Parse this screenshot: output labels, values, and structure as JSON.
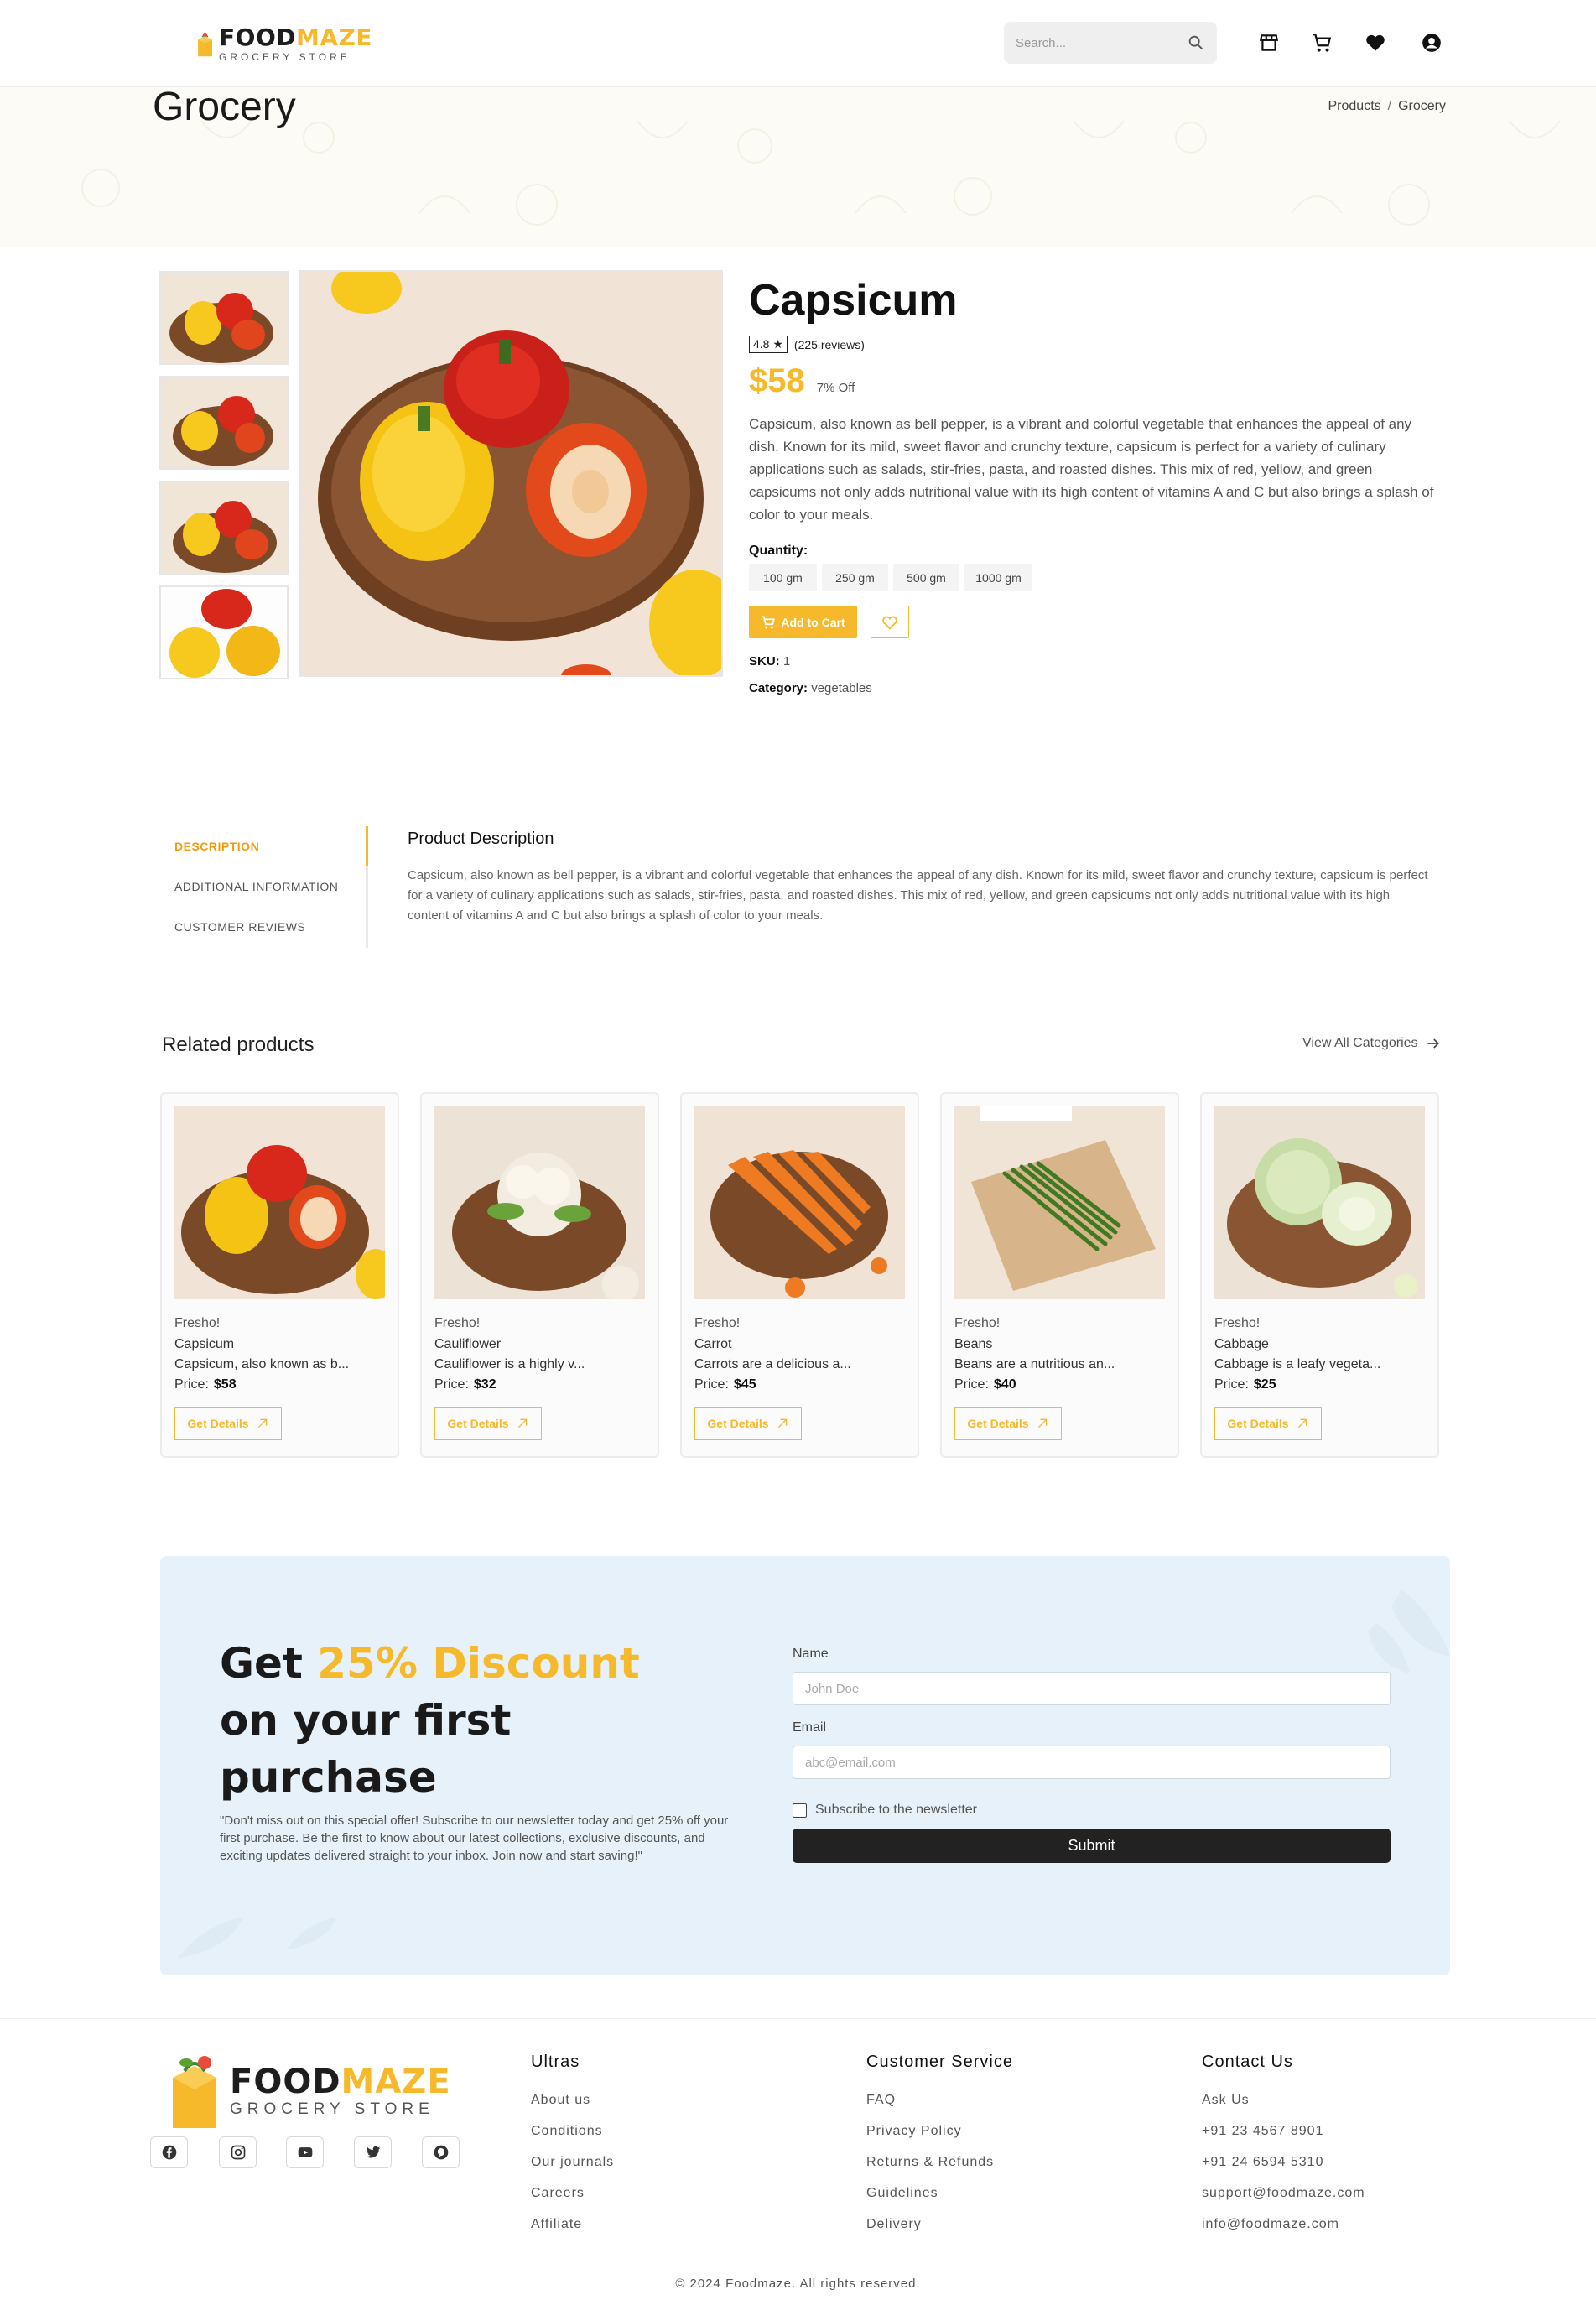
{
  "header": {
    "brand_food": "FOOD",
    "brand_maze": "MAZE",
    "brand_sub": "GROCERY STORE",
    "search_placeholder": "Search..."
  },
  "banner": {
    "title": "Grocery",
    "breadcrumb": [
      "Products",
      "Grocery"
    ],
    "breadcrumb_sep": "/"
  },
  "product": {
    "title": "Capsicum",
    "rating": "4.8 ★",
    "reviews": "(225 reviews)",
    "price": "$58",
    "discount": "7% Off",
    "description": "Capsicum, also known as bell pepper, is a vibrant and colorful vegetable that enhances the appeal of any dish. Known for its mild, sweet flavor and crunchy texture, capsicum is perfect for a variety of culinary applications such as salads, stir-fries, pasta, and roasted dishes. This mix of red, yellow, and green capsicums not only adds nutritional value with its high content of vitamins A and C but also brings a splash of color to your meals.",
    "quantity_label": "Quantity:",
    "quantities": [
      "100 gm",
      "250 gm",
      "500 gm",
      "1000 gm"
    ],
    "add_to_cart": "Add to Cart",
    "sku_label": "SKU:",
    "sku_value": "1",
    "category_label": "Category:",
    "category_value": "vegetables"
  },
  "tabs": {
    "items": [
      "DESCRIPTION",
      "ADDITIONAL INFORMATION",
      "CUSTOMER REVIEWS"
    ],
    "heading": "Product Description",
    "body": "Capsicum, also known as bell pepper, is a vibrant and colorful vegetable that enhances the appeal of any dish. Known for its mild, sweet flavor and crunchy texture, capsicum is perfect for a variety of culinary applications such as salads, stir-fries, pasta, and roasted dishes. This mix of red, yellow, and green capsicums not only adds nutritional value with its high content of vitamins A and C but also brings a splash of color to your meals."
  },
  "related": {
    "heading": "Related products",
    "view_all": "View All Categories",
    "cards": [
      {
        "tag": "Fresho!",
        "name": "Capsicum",
        "short": "Capsicum, also known as b...",
        "price_label": "Price:",
        "price": "$58",
        "button": "Get Details"
      },
      {
        "tag": "Fresho!",
        "name": "Cauliflower",
        "short": "Cauliflower is a highly v...",
        "price_label": "Price:",
        "price": "$32",
        "button": "Get Details"
      },
      {
        "tag": "Fresho!",
        "name": "Carrot",
        "short": "Carrots are a delicious a...",
        "price_label": "Price:",
        "price": "$45",
        "button": "Get Details"
      },
      {
        "tag": "Fresho!",
        "name": "Beans",
        "short": "Beans are a nutritious an...",
        "price_label": "Price:",
        "price": "$40",
        "button": "Get Details"
      },
      {
        "tag": "Fresho!",
        "name": "Cabbage",
        "short": "Cabbage is a leafy vegeta...",
        "price_label": "Price:",
        "price": "$25",
        "button": "Get Details"
      }
    ]
  },
  "newsletter": {
    "heading_1": "Get ",
    "heading_highlight": "25% Discount",
    "heading_2": "on your first purchase",
    "body": "\"Don't miss out on this special offer! Subscribe to our newsletter today and get 25% off your first purchase. Be the first to know about our latest collections, exclusive discounts, and exciting updates delivered straight to your inbox. Join now and start saving!\"",
    "name_label": "Name",
    "name_placeholder": "John Doe",
    "email_label": "Email",
    "email_placeholder": "abc@email.com",
    "subscribe_label": "Subscribe to the newsletter",
    "submit": "Submit"
  },
  "footer": {
    "brand_food": "FOOD",
    "brand_maze": "MAZE",
    "brand_sub": "GROCERY STORE",
    "social": [
      "facebook-icon",
      "instagram-icon",
      "youtube-icon",
      "twitter-icon",
      "pinterest-icon"
    ],
    "col1": {
      "title": "Ultras",
      "items": [
        "About us",
        "Conditions",
        "Our journals",
        "Careers",
        "Affiliate"
      ]
    },
    "col2": {
      "title": "Customer Service",
      "items": [
        "FAQ",
        "Privacy Policy",
        "Returns & Refunds",
        "Guidelines",
        "Delivery"
      ]
    },
    "col3": {
      "title": "Contact Us",
      "items": [
        "Ask Us",
        "+91 23 4567 8901",
        "+91 24 6594 5310",
        "support@foodmaze.com",
        "info@foodmaze.com"
      ]
    },
    "copyright": "© 2024 Foodmaze. All rights reserved."
  },
  "colors": {
    "accent": "#f6b92c",
    "tab_active": "#f39c12",
    "newsletter_bg": "#e6f1f9",
    "banner_bg": "#fdfbf6",
    "submit_bg": "#222222"
  }
}
